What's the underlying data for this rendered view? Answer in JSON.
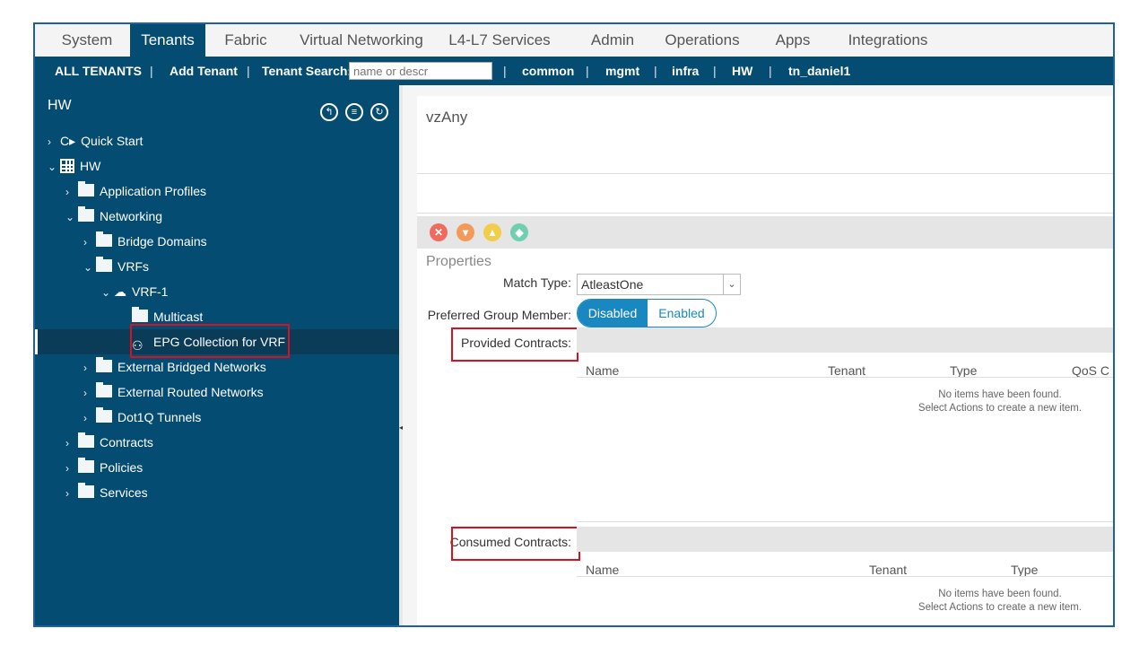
{
  "top_tabs": [
    {
      "label": "System"
    },
    {
      "label": "Tenants",
      "active": true
    },
    {
      "label": "Fabric"
    },
    {
      "label": "Virtual Networking"
    },
    {
      "label": "L4-L7 Services"
    },
    {
      "label": "Admin"
    },
    {
      "label": "Operations"
    },
    {
      "label": "Apps"
    },
    {
      "label": "Integrations"
    }
  ],
  "sub_nav": {
    "all_tenants": "ALL TENANTS",
    "add_tenant": "Add Tenant",
    "tenant_search_label": "Tenant Search:",
    "tenant_search_placeholder": "name or descr",
    "separator": "|",
    "tenants": [
      "common",
      "mgmt",
      "infra",
      "HW",
      "tn_daniel1"
    ],
    "current_tenant": "HW"
  },
  "left_pane": {
    "title": "HW",
    "tree": {
      "quick_start": "Quick Start",
      "hw": "HW",
      "application_profiles": "Application Profiles",
      "networking": "Networking",
      "bridge_domains": "Bridge Domains",
      "vrfs": "VRFs",
      "vrf1": "VRF-1",
      "multicast": "Multicast",
      "epg_collection": "EPG Collection for VRF",
      "external_bridged": "External Bridged Networks",
      "external_routed": "External Routed Networks",
      "dot1q": "Dot1Q Tunnels",
      "contracts": "Contracts",
      "policies": "Policies",
      "services": "Services"
    }
  },
  "right_pane": {
    "title": "vzAny",
    "properties_label": "Properties",
    "match_type_label": "Match Type:",
    "match_type_value": "AtleastOne",
    "preferred_group_label": "Preferred Group Member:",
    "preferred_group_options": [
      "Disabled",
      "Enabled"
    ],
    "preferred_group_selected": "Disabled",
    "provided": {
      "label": "Provided Contracts:",
      "columns": [
        "Name",
        "Tenant",
        "Type",
        "QoS C"
      ],
      "empty_line1": "No items have been found.",
      "empty_line2": "Select Actions to create a new item."
    },
    "consumed": {
      "label": "Consumed Contracts:",
      "columns": [
        "Name",
        "Tenant",
        "Type"
      ],
      "empty_line1": "No items have been found.",
      "empty_line2": "Select Actions to create a new item."
    }
  },
  "colors": {
    "nav_dark": "#044c71",
    "highlight_red": "#d9101f",
    "toggle_blue": "#1a88c0",
    "fault_critical": "#f06a5e",
    "fault_major": "#f39a5a",
    "fault_minor": "#f2cd4a",
    "fault_warning": "#6fcfb0"
  }
}
